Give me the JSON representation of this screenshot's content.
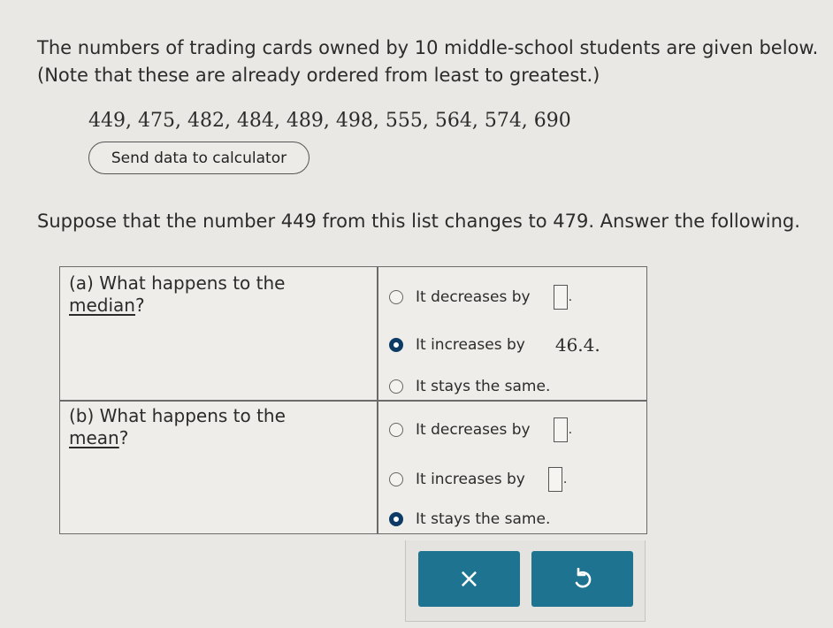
{
  "intro": {
    "line1": "The numbers of trading cards owned by 10 middle-school students are given below.",
    "line2": "(Note that these are already ordered from least to greatest.)",
    "data_list": "449, 475, 482, 484, 489, 498, 555, 564, 574, 690"
  },
  "send_button": "Send data to calculator",
  "prompt": "Suppose that the number 449 from this list changes to 479. Answer the following.",
  "part_a": {
    "label_prefix": "(a) What happens to the",
    "term": "median",
    "suffix": "?",
    "options": [
      {
        "text": "It decreases by",
        "selected": false,
        "value": ""
      },
      {
        "text": "It increases by",
        "selected": true,
        "value": "46.4."
      },
      {
        "text": "It stays the same.",
        "selected": false
      }
    ]
  },
  "part_b": {
    "label_prefix": "(b) What happens to the",
    "term": "mean",
    "suffix": "?",
    "options": [
      {
        "text": "It decreases by",
        "selected": false,
        "value": ""
      },
      {
        "text": "It increases by",
        "selected": false,
        "value": ""
      },
      {
        "text": "It stays the same.",
        "selected": true
      }
    ]
  },
  "actions": {
    "clear_icon": "×",
    "undo_icon_name": "undo-icon"
  },
  "colors": {
    "accent": "#1d7390",
    "radio_selected": "#0d3b66"
  }
}
